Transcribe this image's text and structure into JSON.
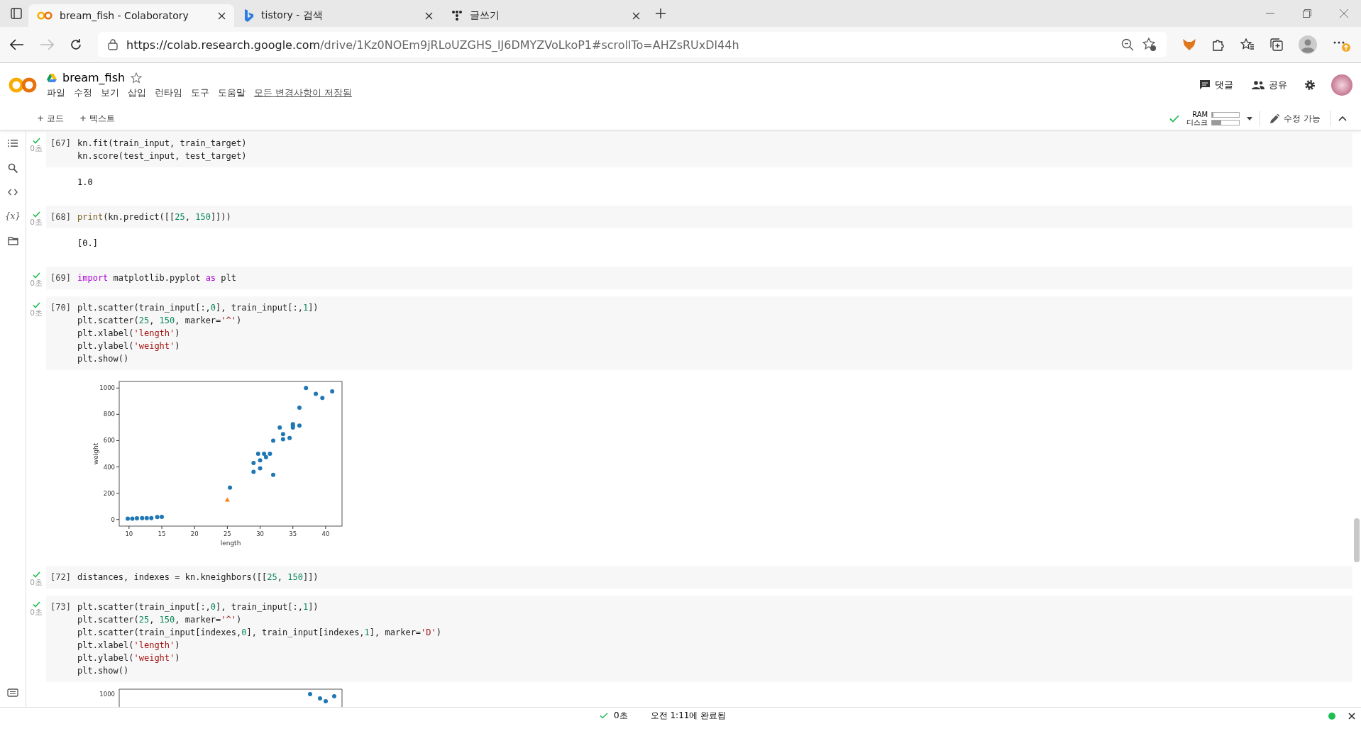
{
  "browser": {
    "tabs": [
      {
        "title": "bream_fish - Colaboratory",
        "selected": true
      },
      {
        "title": "tistory - 검색",
        "selected": false
      },
      {
        "title": "글쓰기",
        "selected": false
      }
    ],
    "url_host": "https://colab.research.google.com",
    "url_path": "/drive/1Kz0NOEm9jRLoUZGHS_lJ6DMYZVoLkoP1#scrollTo=AHZsRUxDl44h"
  },
  "notebook": {
    "title": "bream_fish",
    "menu": [
      "파일",
      "수정",
      "보기",
      "삽입",
      "런타임",
      "도구",
      "도움말"
    ],
    "save_status": "모든 변경사항이 저장됨",
    "comment": "댓글",
    "share": "공유"
  },
  "toolbar": {
    "add_code": "+ 코드",
    "add_text": "+ 텍스트",
    "ram_label": "RAM",
    "disk_label": "디스크",
    "ram": {
      "level": 0.05
    },
    "disk": {
      "level": 0.35
    },
    "edit_mode": "수정 가능"
  },
  "sidebar": {
    "variables": "{x}"
  },
  "cells": [
    {
      "kind": "code",
      "number": "[67]",
      "time": "0초",
      "lines": [
        [
          {
            "t": "kn.fit(train_input, train_target)",
            "kind": "plain"
          }
        ],
        [
          {
            "t": "kn.score(test_input, test_target)",
            "kind": "plain"
          }
        ]
      ],
      "output": "1.0"
    },
    {
      "kind": "code",
      "number": "[68]",
      "time": "0초",
      "lines": [
        [
          {
            "t": "print",
            "kind": "fn"
          },
          {
            "t": "(kn.predict([[",
            "kind": "plain"
          },
          {
            "t": "25",
            "kind": "num"
          },
          {
            "t": ", ",
            "kind": "plain"
          },
          {
            "t": "150",
            "kind": "num"
          },
          {
            "t": "]]))",
            "kind": "plain"
          }
        ]
      ],
      "output": "[0.]"
    },
    {
      "kind": "code",
      "number": "[69]",
      "time": "0초",
      "lines": [
        [
          {
            "t": "import",
            "kind": "kw"
          },
          {
            "t": " matplotlib.pyplot ",
            "kind": "plain"
          },
          {
            "t": "as",
            "kind": "kw"
          },
          {
            "t": " plt",
            "kind": "plain"
          }
        ]
      ]
    },
    {
      "kind": "code",
      "number": "[70]",
      "time": "0초",
      "lines": [
        [
          {
            "t": "plt.scatter(train_input[:,",
            "kind": "plain"
          },
          {
            "t": "0",
            "kind": "num"
          },
          {
            "t": "], train_input[:,",
            "kind": "plain"
          },
          {
            "t": "1",
            "kind": "num"
          },
          {
            "t": "])",
            "kind": "plain"
          }
        ],
        [
          {
            "t": "plt.scatter(",
            "kind": "plain"
          },
          {
            "t": "25",
            "kind": "num"
          },
          {
            "t": ", ",
            "kind": "plain"
          },
          {
            "t": "150",
            "kind": "num"
          },
          {
            "t": ", marker=",
            "kind": "plain"
          },
          {
            "t": "'^'",
            "kind": "str"
          },
          {
            "t": ")",
            "kind": "plain"
          }
        ],
        [
          {
            "t": "plt.xlabel(",
            "kind": "plain"
          },
          {
            "t": "'length'",
            "kind": "str"
          },
          {
            "t": ")",
            "kind": "plain"
          }
        ],
        [
          {
            "t": "plt.ylabel(",
            "kind": "plain"
          },
          {
            "t": "'weight'",
            "kind": "str"
          },
          {
            "t": ")",
            "kind": "plain"
          }
        ],
        [
          {
            "t": "plt.show()",
            "kind": "plain"
          }
        ]
      ],
      "chart_data": {
        "type": "scatter",
        "xlabel": "length",
        "ylabel": "weight",
        "xlim": [
          8.5,
          42.5
        ],
        "ylim": [
          -50,
          1050
        ],
        "xticks": [
          10,
          15,
          20,
          25,
          30,
          35,
          40
        ],
        "yticks": [
          0,
          200,
          400,
          600,
          800,
          1000
        ],
        "series": [
          {
            "color": "#1f77b4",
            "x": [
              9.8,
              10.5,
              11.2,
              12,
              12.7,
              13.4,
              14.3,
              15,
              25.4,
              29,
              29,
              29.7,
              30,
              30,
              30.6,
              30.9,
              31.5,
              32,
              32,
              33,
              33.5,
              33.5,
              34.5,
              35,
              35,
              35,
              36,
              36,
              37,
              38.5,
              39.5,
              41
            ],
            "values": [
              6,
              7,
              9,
              10,
              10,
              10,
              19,
              20,
              242,
              430,
              363,
              500,
              390,
              450,
              500,
              475,
              500,
              600,
              340,
              700,
              650,
              610,
              620,
              700,
              725,
              713,
              850,
              714,
              1000,
              955,
              925,
              975
            ]
          },
          {
            "color": "#ff7f0e",
            "x": [
              25
            ],
            "values": [
              150
            ]
          }
        ]
      }
    },
    {
      "kind": "code",
      "number": "[72]",
      "time": "0초",
      "lines": [
        [
          {
            "t": "distances, indexes = kn.kneighbors([[",
            "kind": "plain"
          },
          {
            "t": "25",
            "kind": "num"
          },
          {
            "t": ", ",
            "kind": "plain"
          },
          {
            "t": "150",
            "kind": "num"
          },
          {
            "t": "]])",
            "kind": "plain"
          }
        ]
      ]
    },
    {
      "kind": "code",
      "number": "[73]",
      "time": "0초",
      "lines": [
        [
          {
            "t": "plt.scatter(train_input[:,",
            "kind": "plain"
          },
          {
            "t": "0",
            "kind": "num"
          },
          {
            "t": "], train_input[:,",
            "kind": "plain"
          },
          {
            "t": "1",
            "kind": "num"
          },
          {
            "t": "])",
            "kind": "plain"
          }
        ],
        [
          {
            "t": "plt.scatter(",
            "kind": "plain"
          },
          {
            "t": "25",
            "kind": "num"
          },
          {
            "t": ", ",
            "kind": "plain"
          },
          {
            "t": "150",
            "kind": "num"
          },
          {
            "t": ", marker=",
            "kind": "plain"
          },
          {
            "t": "'^'",
            "kind": "str"
          },
          {
            "t": ")",
            "kind": "plain"
          }
        ],
        [
          {
            "t": "plt.scatter(train_input[indexes,",
            "kind": "plain"
          },
          {
            "t": "0",
            "kind": "num"
          },
          {
            "t": "], train_input[indexes,",
            "kind": "plain"
          },
          {
            "t": "1",
            "kind": "num"
          },
          {
            "t": "], marker=",
            "kind": "plain"
          },
          {
            "t": "'D'",
            "kind": "str"
          },
          {
            "t": ")",
            "kind": "plain"
          }
        ],
        [
          {
            "t": "plt.xlabel(",
            "kind": "plain"
          },
          {
            "t": "'length'",
            "kind": "str"
          },
          {
            "t": ")",
            "kind": "plain"
          }
        ],
        [
          {
            "t": "plt.ylabel(",
            "kind": "plain"
          },
          {
            "t": "'weight'",
            "kind": "str"
          },
          {
            "t": ")",
            "kind": "plain"
          }
        ],
        [
          {
            "t": "plt.show()",
            "kind": "plain"
          }
        ]
      ],
      "partial_plot": {
        "ytick": "1000"
      }
    }
  ],
  "status_bar": {
    "duration": "0초",
    "message": "오전 1:11에 완료됨"
  }
}
